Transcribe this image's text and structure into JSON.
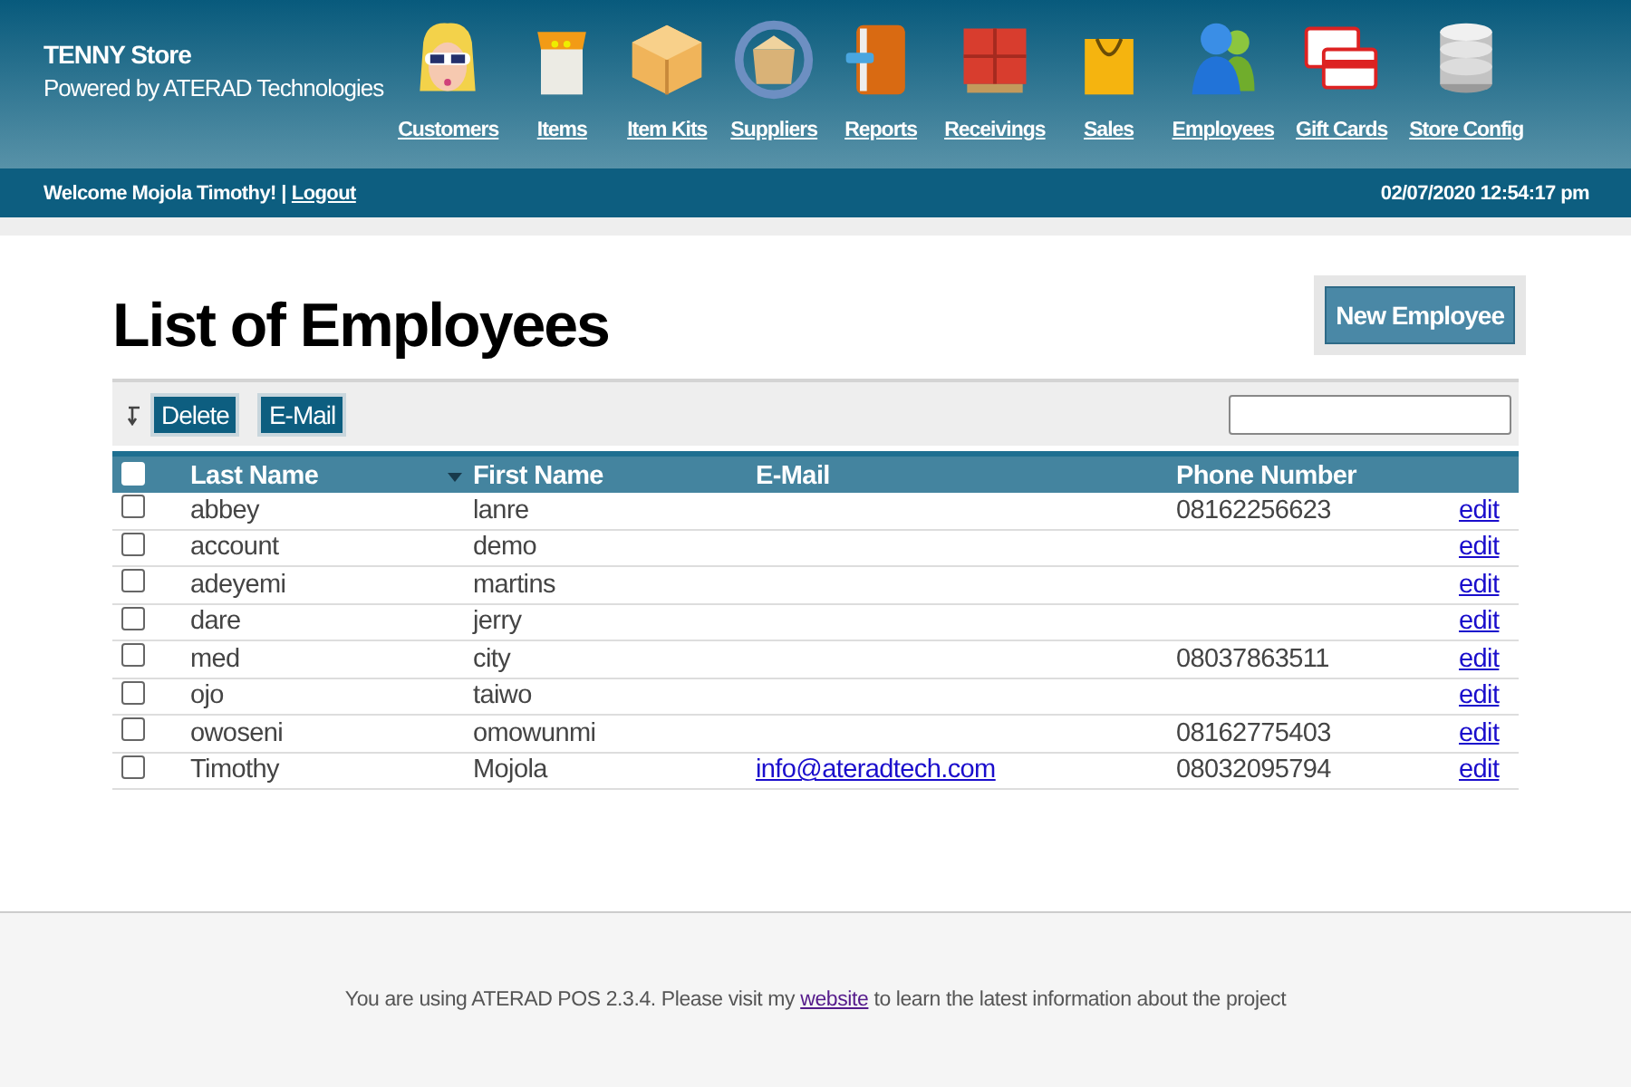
{
  "header": {
    "store_name": "TENNY Store",
    "powered_by": "Powered by ATERAD Technologies",
    "nav": [
      {
        "label": "Customers"
      },
      {
        "label": "Items"
      },
      {
        "label": "Item Kits"
      },
      {
        "label": "Suppliers"
      },
      {
        "label": "Reports"
      },
      {
        "label": "Receivings"
      },
      {
        "label": "Sales"
      },
      {
        "label": "Employees"
      },
      {
        "label": "Gift Cards"
      },
      {
        "label": "Store Config"
      }
    ]
  },
  "user_bar": {
    "welcome": "Welcome Mojola Timothy! |",
    "logout": "Logout",
    "datetime": "02/07/2020 12:54:17 pm"
  },
  "page": {
    "title": "List of Employees",
    "new_button": "New Employee"
  },
  "toolbar": {
    "buttons": [
      "Delete",
      "E-Mail"
    ]
  },
  "table": {
    "select_all": {
      "checked": false
    },
    "columns": [
      {
        "label": "Last Name",
        "sorted": true
      },
      {
        "label": "First Name",
        "sorted": false
      },
      {
        "label": "E-Mail",
        "sorted": false
      },
      {
        "label": "Phone Number",
        "sorted": false
      }
    ],
    "rows": [
      {
        "selected": false,
        "last_name": "abbey",
        "first_name": "lanre",
        "email": "",
        "phone": "08162256623",
        "action": "edit"
      },
      {
        "selected": false,
        "last_name": "account",
        "first_name": "demo",
        "email": "",
        "phone": "",
        "action": "edit"
      },
      {
        "selected": false,
        "last_name": "adeyemi",
        "first_name": "martins",
        "email": "",
        "phone": "",
        "action": "edit"
      },
      {
        "selected": false,
        "last_name": "dare",
        "first_name": "jerry",
        "email": "",
        "phone": "",
        "action": "edit"
      },
      {
        "selected": false,
        "last_name": "med",
        "first_name": "city",
        "email": "",
        "phone": "08037863511",
        "action": "edit"
      },
      {
        "selected": false,
        "last_name": "ojo",
        "first_name": "taiwo",
        "email": "",
        "phone": "",
        "action": "edit"
      },
      {
        "selected": false,
        "last_name": "owoseni",
        "first_name": "omowunmi",
        "email": "",
        "phone": "08162775403",
        "action": "edit"
      },
      {
        "selected": false,
        "last_name": "Timothy",
        "first_name": "Mojola",
        "email": "info@ateradtech.com",
        "phone": "08032095794",
        "action": "edit"
      }
    ]
  },
  "footer": {
    "before": "You are using ATERAD POS 2.3.4. Please visit my",
    "link": "website",
    "after": "to learn the latest information about the project"
  }
}
